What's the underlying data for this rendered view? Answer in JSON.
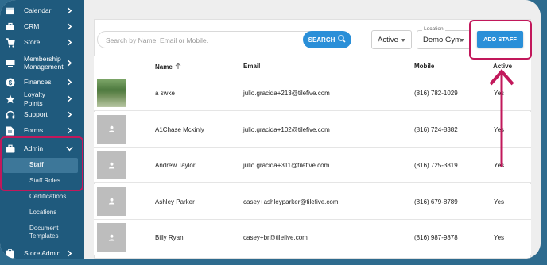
{
  "sidebar": {
    "items": [
      {
        "label": "Calendar",
        "icon": "calendar-icon"
      },
      {
        "label": "CRM",
        "icon": "crm-icon"
      },
      {
        "label": "Store",
        "icon": "cart-icon"
      },
      {
        "label": "Membership Management",
        "icon": "membership-icon"
      },
      {
        "label": "Finances",
        "icon": "dollar-icon"
      },
      {
        "label": "Loyalty Points",
        "icon": "star-icon"
      },
      {
        "label": "Support",
        "icon": "headset-icon"
      },
      {
        "label": "Forms",
        "icon": "document-icon"
      },
      {
        "label": "Admin",
        "icon": "briefcase-icon"
      },
      {
        "label": "Store Admin",
        "icon": "clipboard-icon"
      }
    ],
    "admin_sub": [
      "Staff",
      "Staff Roles",
      "Certifications",
      "Locations",
      "Document Templates"
    ]
  },
  "toolbar": {
    "search_placeholder": "Search by Name, Email or Mobile.",
    "search_button": "SEARCH",
    "status_value": "Active",
    "location_label": "Location",
    "location_value": "Demo Gym",
    "add_button": "ADD STAFF"
  },
  "table": {
    "headers": {
      "name": "Name",
      "email": "Email",
      "mobile": "Mobile",
      "active": "Active"
    },
    "rows": [
      {
        "name": "a swke",
        "email": "julio.gracida+213@tilefive.com",
        "mobile": "(816) 782-1029",
        "active": "Yes",
        "photo": true
      },
      {
        "name": "A1Chase Mckinly",
        "email": "julio.gracida+102@tilefive.com",
        "mobile": "(816) 724-8382",
        "active": "Yes",
        "photo": false
      },
      {
        "name": "Andrew Taylor",
        "email": "julio.gracida+311@tilefive.com",
        "mobile": "(816) 725-3819",
        "active": "Yes",
        "photo": false
      },
      {
        "name": "Ashley Parker",
        "email": "casey+ashleyparker@tilefive.com",
        "mobile": "(816) 679-8789",
        "active": "Yes",
        "photo": false
      },
      {
        "name": "Billy Ryan",
        "email": "casey+br@tilefive.com",
        "mobile": "(816) 987-9878",
        "active": "Yes",
        "photo": false
      }
    ]
  },
  "colors": {
    "sidebar": "#1f5a7d",
    "accent": "#2a8fd8",
    "highlight": "#c2185b"
  }
}
